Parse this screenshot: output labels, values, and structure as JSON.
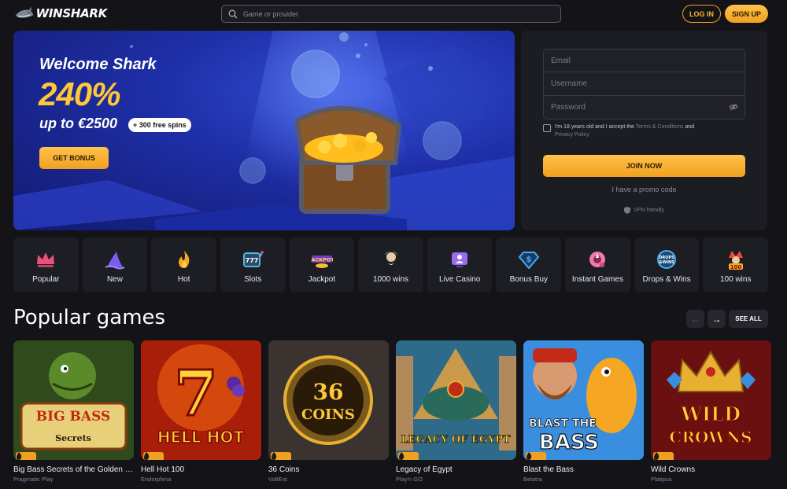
{
  "header": {
    "logo_text": "WINSHARK",
    "search_placeholder": "Game or provider",
    "login_label": "LOG IN",
    "signup_label": "SIGN UP"
  },
  "banner": {
    "welcome": "Welcome Shark",
    "percent": "240%",
    "upto": "up to €2500",
    "spins": "+ 300 free spins",
    "cta": "GET BONUS"
  },
  "signup_form": {
    "email_placeholder": "Email",
    "username_placeholder": "Username",
    "password_placeholder": "Password",
    "terms_prefix": "I'm 18 years old and I accept the",
    "terms_link": "Terms & Conditions",
    "terms_and": "and",
    "privacy_link": "Privacy Policy",
    "join_label": "JOIN NOW",
    "promo_label": "I have a promo code",
    "vpn_label": "VPN friendly"
  },
  "categories": [
    {
      "label": "Popular",
      "icon": "crown-icon",
      "color": "#e8527a"
    },
    {
      "label": "New",
      "icon": "shark-fin-icon",
      "color": "#7b5cf0"
    },
    {
      "label": "Hot",
      "icon": "flame-icon",
      "color": "#f5a623"
    },
    {
      "label": "Slots",
      "icon": "slot-machine-icon",
      "color": "#5ab4e0"
    },
    {
      "label": "Jackpot",
      "icon": "jackpot-icon",
      "color": "#f5c030"
    },
    {
      "label": "1000 wins",
      "icon": "zeus-icon",
      "color": "#c8c8d0"
    },
    {
      "label": "Live Casino",
      "icon": "live-casino-icon",
      "color": "#9a6af0"
    },
    {
      "label": "Bonus Buy",
      "icon": "diamond-dollar-icon",
      "color": "#4aa8f0"
    },
    {
      "label": "Instant Games",
      "icon": "instant-games-icon",
      "color": "#f07aa8"
    },
    {
      "label": "Drops & Wins",
      "icon": "drops-wins-icon",
      "color": "#4ab0f0"
    },
    {
      "label": "100 wins",
      "icon": "jester-100-icon",
      "color": "#f5a623"
    }
  ],
  "popular": {
    "title": "Popular games",
    "see_all": "SEE ALL",
    "prev_icon": "arrow-left-icon",
    "next_icon": "arrow-right-icon"
  },
  "games": [
    {
      "title": "Big Bass Secrets of the Golden Lake",
      "provider": "Pragmatic Play",
      "art": "BIG BASS",
      "bg": "#2f4a1c"
    },
    {
      "title": "Hell Hot 100",
      "provider": "Endorphina",
      "art": "HELL HOT",
      "bg": "#a81e08"
    },
    {
      "title": "36 Coins",
      "provider": "VoltEnt",
      "art": "36 COINS",
      "bg": "#3a3330"
    },
    {
      "title": "Legacy of Egypt",
      "provider": "Play'n GO",
      "art": "LEGACY OF EGYPT",
      "bg": "#2e6b8a"
    },
    {
      "title": "Blast the Bass",
      "provider": "Belatra",
      "art": "BLAST THE BASS",
      "bg": "#3a8ee0"
    },
    {
      "title": "Wild Crowns",
      "provider": "Platipus",
      "art": "WILD CROWNS",
      "bg": "#6a1010"
    }
  ]
}
